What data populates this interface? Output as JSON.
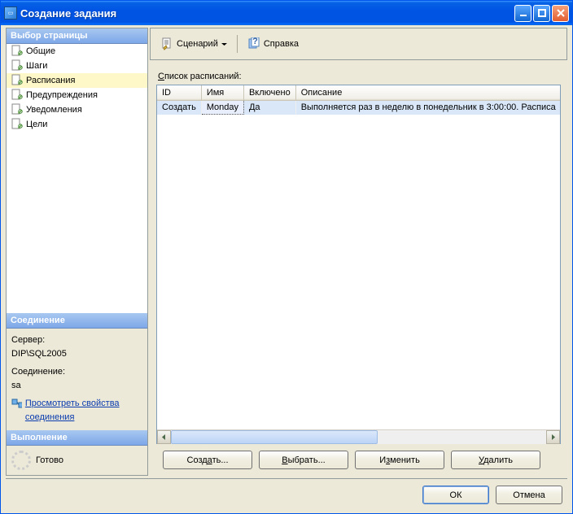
{
  "window": {
    "title": "Создание задания"
  },
  "sidebar": {
    "pages_header": "Выбор страницы",
    "connection_header": "Соединение",
    "execution_header": "Выполнение",
    "pages": [
      {
        "label": "Общие",
        "selected": false
      },
      {
        "label": "Шаги",
        "selected": false
      },
      {
        "label": "Расписания",
        "selected": true
      },
      {
        "label": "Предупреждения",
        "selected": false
      },
      {
        "label": "Уведомления",
        "selected": false
      },
      {
        "label": "Цели",
        "selected": false
      }
    ]
  },
  "connection": {
    "server_label": "Сервер:",
    "server_value": "DIP\\SQL2005",
    "conn_label": "Соединение:",
    "conn_value": "sa",
    "link_text": "Просмотреть свойства соединения"
  },
  "execution": {
    "status": "Готово"
  },
  "toolbar": {
    "script": "Сценарий",
    "help": "Справка"
  },
  "main": {
    "list_label_u": "С",
    "list_label_rest": "писок расписаний:",
    "columns": [
      "ID",
      "Имя",
      "Включено",
      "Описание"
    ],
    "rows": [
      {
        "id": "Создать",
        "name": "Monday",
        "enabled": "Да",
        "desc": "Выполняется раз в неделю в понедельник в 3:00:00. Расписа",
        "selected": true
      }
    ]
  },
  "buttons": {
    "create_pre": "Созд",
    "create_u": "а",
    "create_post": "ть...",
    "pick_u": "В",
    "pick_post": "ыбрать...",
    "edit_pre": "И",
    "edit_u": "з",
    "edit_post": "менить",
    "delete_u": "У",
    "delete_post": "далить"
  },
  "footer": {
    "ok": "ОК",
    "cancel": "Отмена"
  }
}
